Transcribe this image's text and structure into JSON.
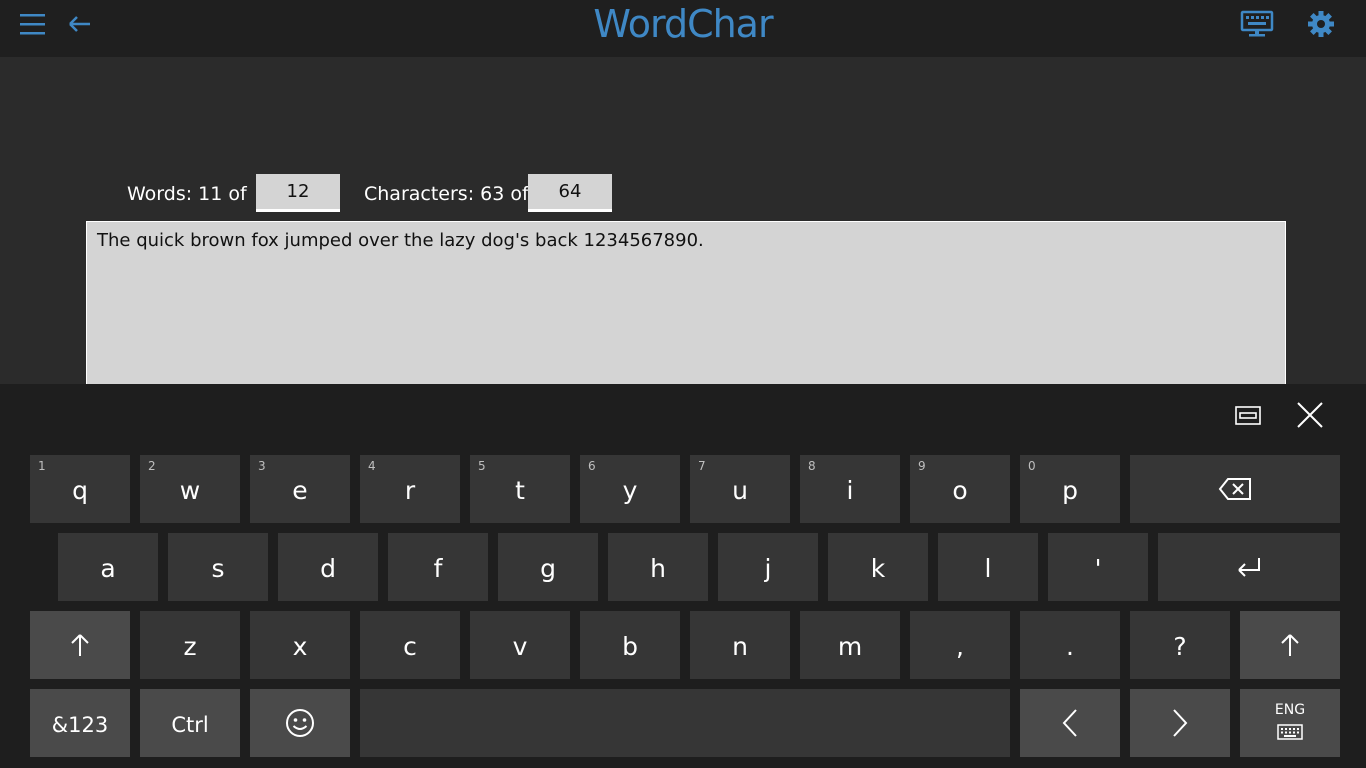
{
  "app": {
    "title": "WordChar",
    "accent_color": "#3f88c5",
    "icons": [
      "hamburger-menu-icon",
      "back-arrow-icon",
      "keyboard-display-icon",
      "gear-icon"
    ]
  },
  "counters": {
    "words_label": "Words: 11 of",
    "words_limit": "12",
    "chars_label": "Characters: 63 of",
    "chars_limit": "64"
  },
  "editor": {
    "text": "The quick brown fox jumped over the lazy dog's back 1234567890."
  },
  "keyboard": {
    "row1": [
      {
        "label": "q",
        "hint": "1"
      },
      {
        "label": "w",
        "hint": "2"
      },
      {
        "label": "e",
        "hint": "3"
      },
      {
        "label": "r",
        "hint": "4"
      },
      {
        "label": "t",
        "hint": "5"
      },
      {
        "label": "y",
        "hint": "6"
      },
      {
        "label": "u",
        "hint": "7"
      },
      {
        "label": "i",
        "hint": "8"
      },
      {
        "label": "o",
        "hint": "9"
      },
      {
        "label": "p",
        "hint": "0"
      }
    ],
    "row2": [
      "a",
      "s",
      "d",
      "f",
      "g",
      "h",
      "j",
      "k",
      "l",
      "'"
    ],
    "row3": [
      "z",
      "x",
      "c",
      "v",
      "b",
      "n",
      "m",
      ",",
      ".",
      "?"
    ],
    "symbols_label": "&123",
    "ctrl_label": "Ctrl",
    "language_label": "ENG",
    "icons": [
      "dock-keyboard-icon",
      "close-keyboard-icon",
      "backspace-icon",
      "enter-icon",
      "shift-icon",
      "emoji-icon",
      "left-arrow-icon",
      "right-arrow-icon",
      "keyboard-layout-icon"
    ]
  }
}
